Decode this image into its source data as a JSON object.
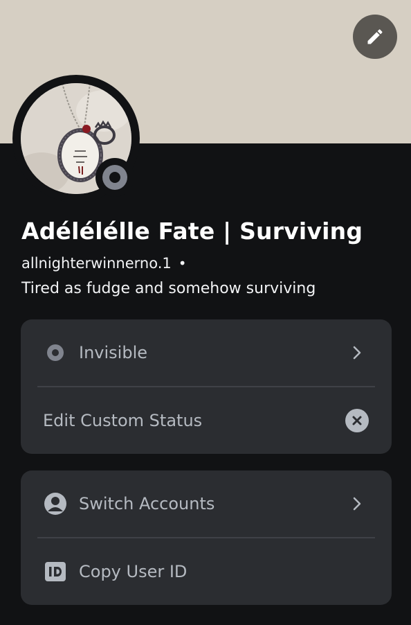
{
  "profile": {
    "display_name": "Adélélélle Fate | Surviving",
    "username": "allnighterwinnerno.1",
    "username_separator": "•",
    "custom_status": "Tired as fudge and somehow surviving"
  },
  "menu": {
    "status": {
      "label": "Invisible",
      "icon": "invisible-status-icon"
    },
    "edit_custom_status": {
      "label": "Edit Custom Status",
      "icon": "clear-x-icon"
    },
    "switch_accounts": {
      "label": "Switch Accounts",
      "icon": "user-circle-icon"
    },
    "copy_user_id": {
      "label": "Copy User ID",
      "icon": "id-badge-icon"
    }
  },
  "colors": {
    "banner": "#d6cfc3",
    "background": "#111214",
    "card": "#2b2d31",
    "status_invisible": "#80848e",
    "text_muted": "#b5bac1"
  }
}
